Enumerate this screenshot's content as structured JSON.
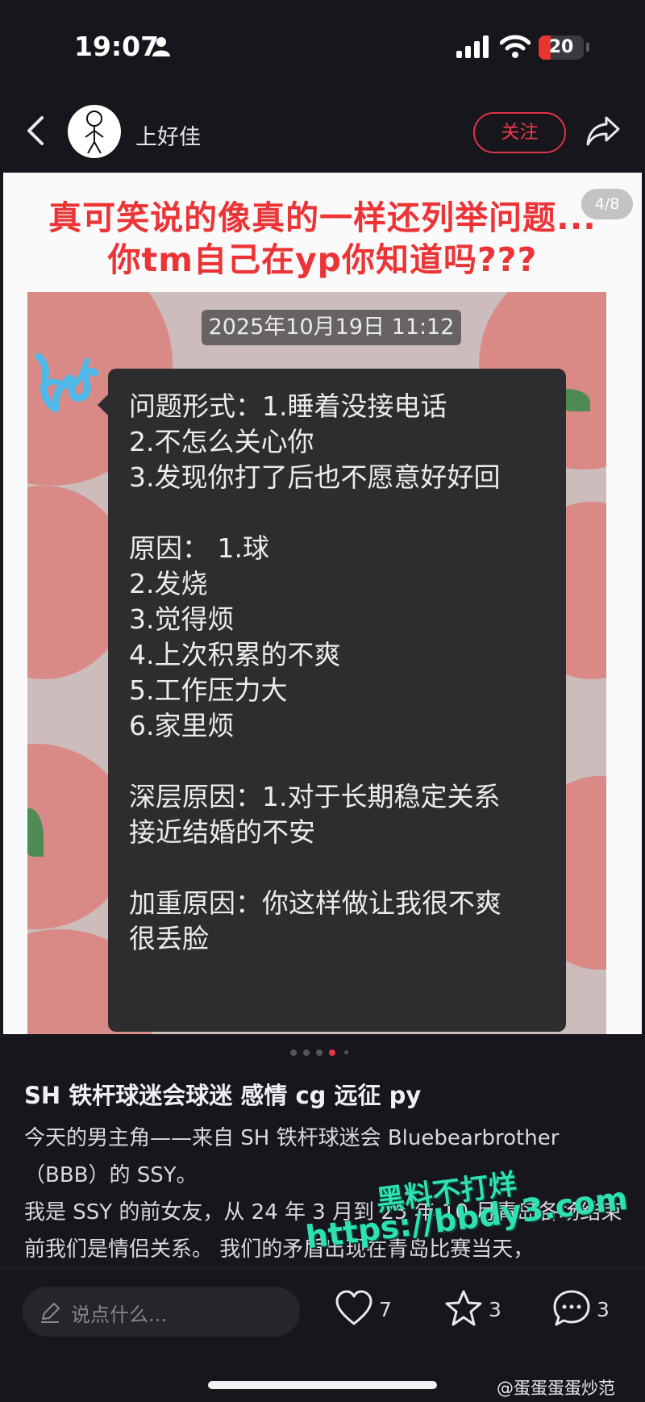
{
  "status_bar": {
    "time": "19:07",
    "battery": "20"
  },
  "header": {
    "username": "上好佳",
    "follow_label": "关注"
  },
  "post_image": {
    "counter": "4/8",
    "caption_line1": "真可笑说的像真的一样还列举问题...",
    "caption_line2": "你tm自己在yp你知道吗???",
    "chat_date": "2025年10月19日 11:12",
    "message_lines": [
      "问题形式：1.睡着没接电话",
      "2.不怎么关心你",
      "3.发现你打了后也不愿意好好回",
      "",
      "原因：  1.球",
      "2.发烧",
      "3.觉得烦",
      "4.上次积累的不爽",
      "5.工作压力大",
      "6.家里烦",
      "",
      "深层原因：1.对于长期稳定关系",
      "接近结婚的不安",
      "",
      "加重原因：你这样做让我很不爽",
      "很丢脸"
    ]
  },
  "pager": {
    "total": 5,
    "active_index": 3
  },
  "post": {
    "title": "SH 铁杆球迷会球迷  感情 cg 远征 py",
    "body": "今天的男主角——来自 SH 铁杆球迷会 Bluebearbrother （BBB）的 SSY。\n我是 SSY 的前女友，从 24 年 3 月到 25 年 10 月青岛各场结束前我们是情侣关系。 我们的矛盾出现在青岛比赛当天，"
  },
  "watermark": {
    "line1": "黑料不打烊",
    "line2": "https://bbdy3.com"
  },
  "bottom_bar": {
    "comment_placeholder": "说点什么...",
    "likes": "7",
    "favorites": "3",
    "comments": "3"
  },
  "credit": "@蛋蛋蛋蛋炒范",
  "colors": {
    "accent": "#ec3448",
    "caption_red": "#ec3437",
    "watermark_green": "#2fe0b0"
  }
}
